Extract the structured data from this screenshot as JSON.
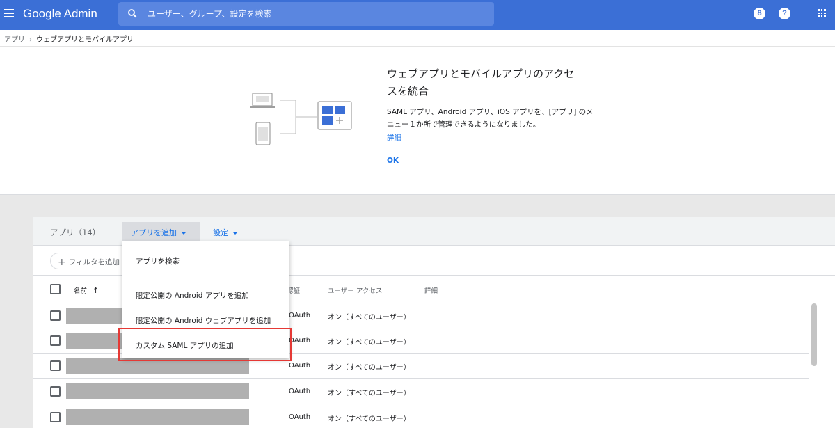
{
  "app": {
    "brand": "Google Admin"
  },
  "search": {
    "placeholder": "ユーザー、グループ、設定を検索"
  },
  "header_icons": {
    "support_label": "8",
    "help_label": "?"
  },
  "breadcrumb": {
    "root": "アプリ",
    "separator": "›",
    "current": "ウェブアプリとモバイルアプリ"
  },
  "promo": {
    "title": "ウェブアプリとモバイルアプリのアクセスを統合",
    "body": "SAML アプリ、Android アプリ、iOS アプリを、[アプリ] のメニュー１か所で管理できるようになりました。",
    "link": "詳細",
    "ok": "OK"
  },
  "apps_panel": {
    "count_label": "アプリ（14）",
    "add_app_label": "アプリを追加",
    "settings_label": "設定",
    "filter_placeholder": "フィルタを追加",
    "columns": {
      "name": "名前",
      "sort": "↑",
      "auth": "認証",
      "access": "ユーザー アクセス",
      "detail": "詳細"
    },
    "rows": [
      {
        "auth": "OAuth",
        "access": "オン（すべてのユーザー）"
      },
      {
        "auth": "OAuth",
        "access": "オン（すべてのユーザー）"
      },
      {
        "auth": "OAuth",
        "access": "オン（すべてのユーザー）"
      },
      {
        "auth": "OAuth",
        "access": "オン（すべてのユーザー）"
      },
      {
        "auth": "OAuth",
        "access": "オン（すべてのユーザー）"
      }
    ]
  },
  "add_app_menu": {
    "items": [
      "アプリを検索",
      "限定公開の Android アプリを追加",
      "限定公開の Android ウェブアプリを追加",
      "カスタム SAML アプリの追加"
    ]
  },
  "colors": {
    "header": "#3b6fd6",
    "accent": "#1a73e8",
    "highlight": "#e53935"
  }
}
